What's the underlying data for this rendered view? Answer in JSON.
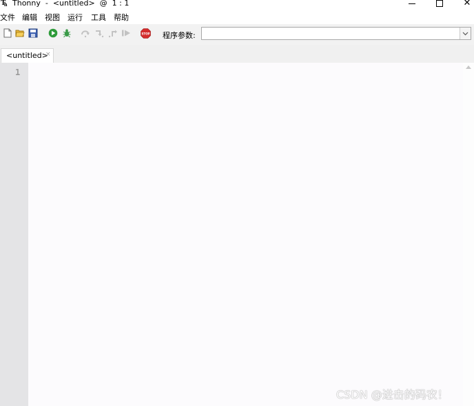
{
  "window": {
    "title": "Thonny  -  <untitled>  @  1 : 1",
    "icon": "thonny-logo-icon",
    "controls": {
      "minimize": "minimize-icon",
      "maximize": "maximize-icon",
      "close": "✕"
    }
  },
  "menubar": {
    "items": [
      "文件",
      "编辑",
      "视图",
      "运行",
      "工具",
      "帮助"
    ]
  },
  "toolbar": {
    "buttons": [
      {
        "name": "new-file",
        "icon": "new-file-icon",
        "enabled": true
      },
      {
        "name": "open-file",
        "icon": "open-folder-icon",
        "enabled": true
      },
      {
        "name": "save-file",
        "icon": "save-icon",
        "enabled": true
      },
      {
        "name": "run",
        "icon": "run-play-icon",
        "enabled": true,
        "color": "#2e9b3a"
      },
      {
        "name": "debug",
        "icon": "debug-bug-icon",
        "enabled": true,
        "color": "#3a9a48"
      },
      {
        "name": "step-over",
        "icon": "step-over-icon",
        "enabled": false
      },
      {
        "name": "step-into",
        "icon": "step-into-icon",
        "enabled": false
      },
      {
        "name": "step-out",
        "icon": "step-out-icon",
        "enabled": false
      },
      {
        "name": "resume",
        "icon": "resume-icon",
        "enabled": false
      },
      {
        "name": "stop",
        "icon": "stop-sign-icon",
        "enabled": true,
        "color": "#d42c2c",
        "text": "STOP"
      }
    ],
    "args_label": "程序参数:",
    "args_value": ""
  },
  "tabs": [
    {
      "label": "<untitled>",
      "close": "×",
      "active": true
    }
  ],
  "editor": {
    "line_numbers": [
      "1"
    ],
    "content": ""
  },
  "watermark": "CSDN @进击的码农！"
}
